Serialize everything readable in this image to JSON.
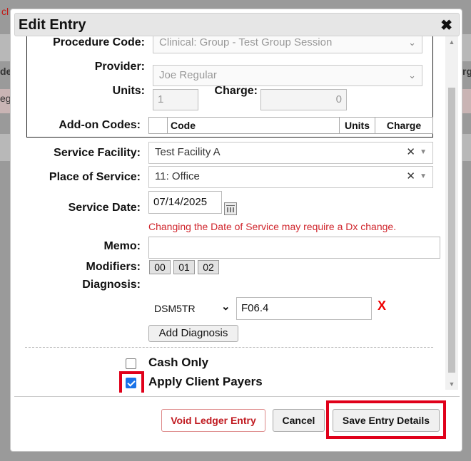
{
  "background": {
    "left_text": "cl",
    "col_a": "de",
    "col_b": "eg",
    "col_c": "rg"
  },
  "dialog": {
    "title": "Edit Entry",
    "close_glyph": "✖"
  },
  "form": {
    "procedure_code": {
      "label": "Procedure Code:",
      "value": "Clinical: Group - Test Group Session"
    },
    "provider": {
      "label": "Provider:",
      "value": "Joe Regular"
    },
    "units": {
      "label": "Units:",
      "value": "1"
    },
    "charge": {
      "label": "Charge:",
      "value": "0"
    },
    "addon_codes": {
      "label": "Add-on Codes:",
      "columns": [
        "Code",
        "Units",
        "Charge"
      ]
    },
    "service_facility": {
      "label": "Service Facility:",
      "value": "Test Facility A"
    },
    "place_of_service": {
      "label": "Place of Service:",
      "value": "11: Office"
    },
    "service_date": {
      "label": "Service Date:",
      "value": "07/14/2025",
      "warning": "Changing the Date of Service may require a Dx change."
    },
    "memo": {
      "label": "Memo:",
      "value": ""
    },
    "modifiers": {
      "label": "Modifiers:",
      "chips": [
        "00",
        "01",
        "02"
      ]
    },
    "diagnosis": {
      "label": "Diagnosis:",
      "code_set": "DSM5TR",
      "code": "F06.4",
      "remove_glyph": "X",
      "add_label": "Add Diagnosis"
    },
    "cash_only": {
      "label": "Cash Only",
      "checked": false
    },
    "apply_client_payers": {
      "label": "Apply Client Payers",
      "checked": true
    }
  },
  "buttons": {
    "void": "Void Ledger Entry",
    "cancel": "Cancel",
    "save": "Save Entry Details"
  },
  "colors": {
    "highlight": "#e0001a",
    "warning": "#d0262d",
    "void_text": "#c0191f",
    "checkbox": "#1a73e8"
  },
  "icons": {
    "close": "close-icon",
    "calendar": "calendar-icon",
    "chevron": "chevron-down-icon",
    "clear": "clear-icon",
    "remove": "remove-diagnosis-icon"
  }
}
